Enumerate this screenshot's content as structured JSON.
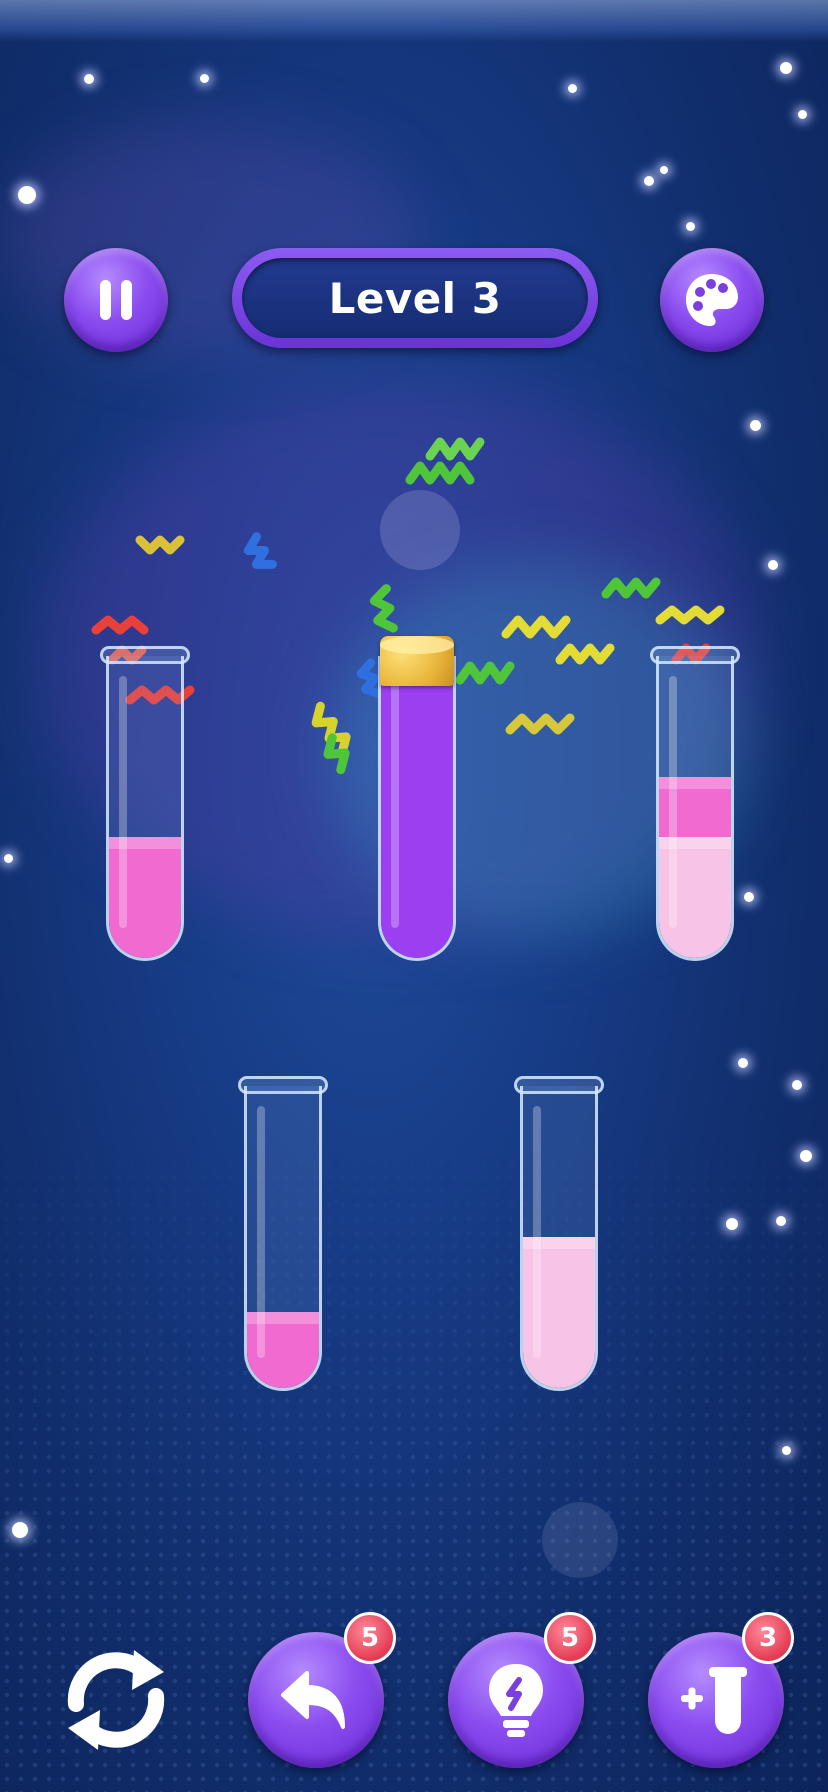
{
  "header": {
    "level_label": "Level 3",
    "pause_icon": "pause-icon",
    "palette_icon": "palette-icon"
  },
  "tubes": [
    {
      "id": "tube-1",
      "color": "#f06ad0",
      "fill_fraction": 0.4,
      "corked": false
    },
    {
      "id": "tube-2",
      "color": "#9b3ff0",
      "fill_fraction": 1.0,
      "corked": true
    },
    {
      "id": "tube-3",
      "colors_bottom_to_top": [
        "#f7c3e6",
        "#f06ad0"
      ],
      "layer_fractions": [
        0.4,
        0.2
      ],
      "corked": false
    },
    {
      "id": "tube-4",
      "color": "#f06ad0",
      "fill_fraction": 0.25,
      "corked": false
    },
    {
      "id": "tube-5",
      "color": "#f7c3e6",
      "fill_fraction": 0.5,
      "corked": false
    }
  ],
  "toolbar": {
    "restart_icon": "restart-icon",
    "undo": {
      "icon": "undo-icon",
      "count": "5"
    },
    "hint": {
      "icon": "lightbulb-icon",
      "count": "5"
    },
    "add_tube": {
      "icon": "add-tube-icon",
      "count": "3"
    }
  },
  "colors": {
    "background": "#173b85",
    "button_purple": "#8a4bef",
    "badge_red": "#e43b54",
    "pink": "#f06ad0",
    "light_pink": "#f7c3e6",
    "purple": "#9b3ff0"
  }
}
